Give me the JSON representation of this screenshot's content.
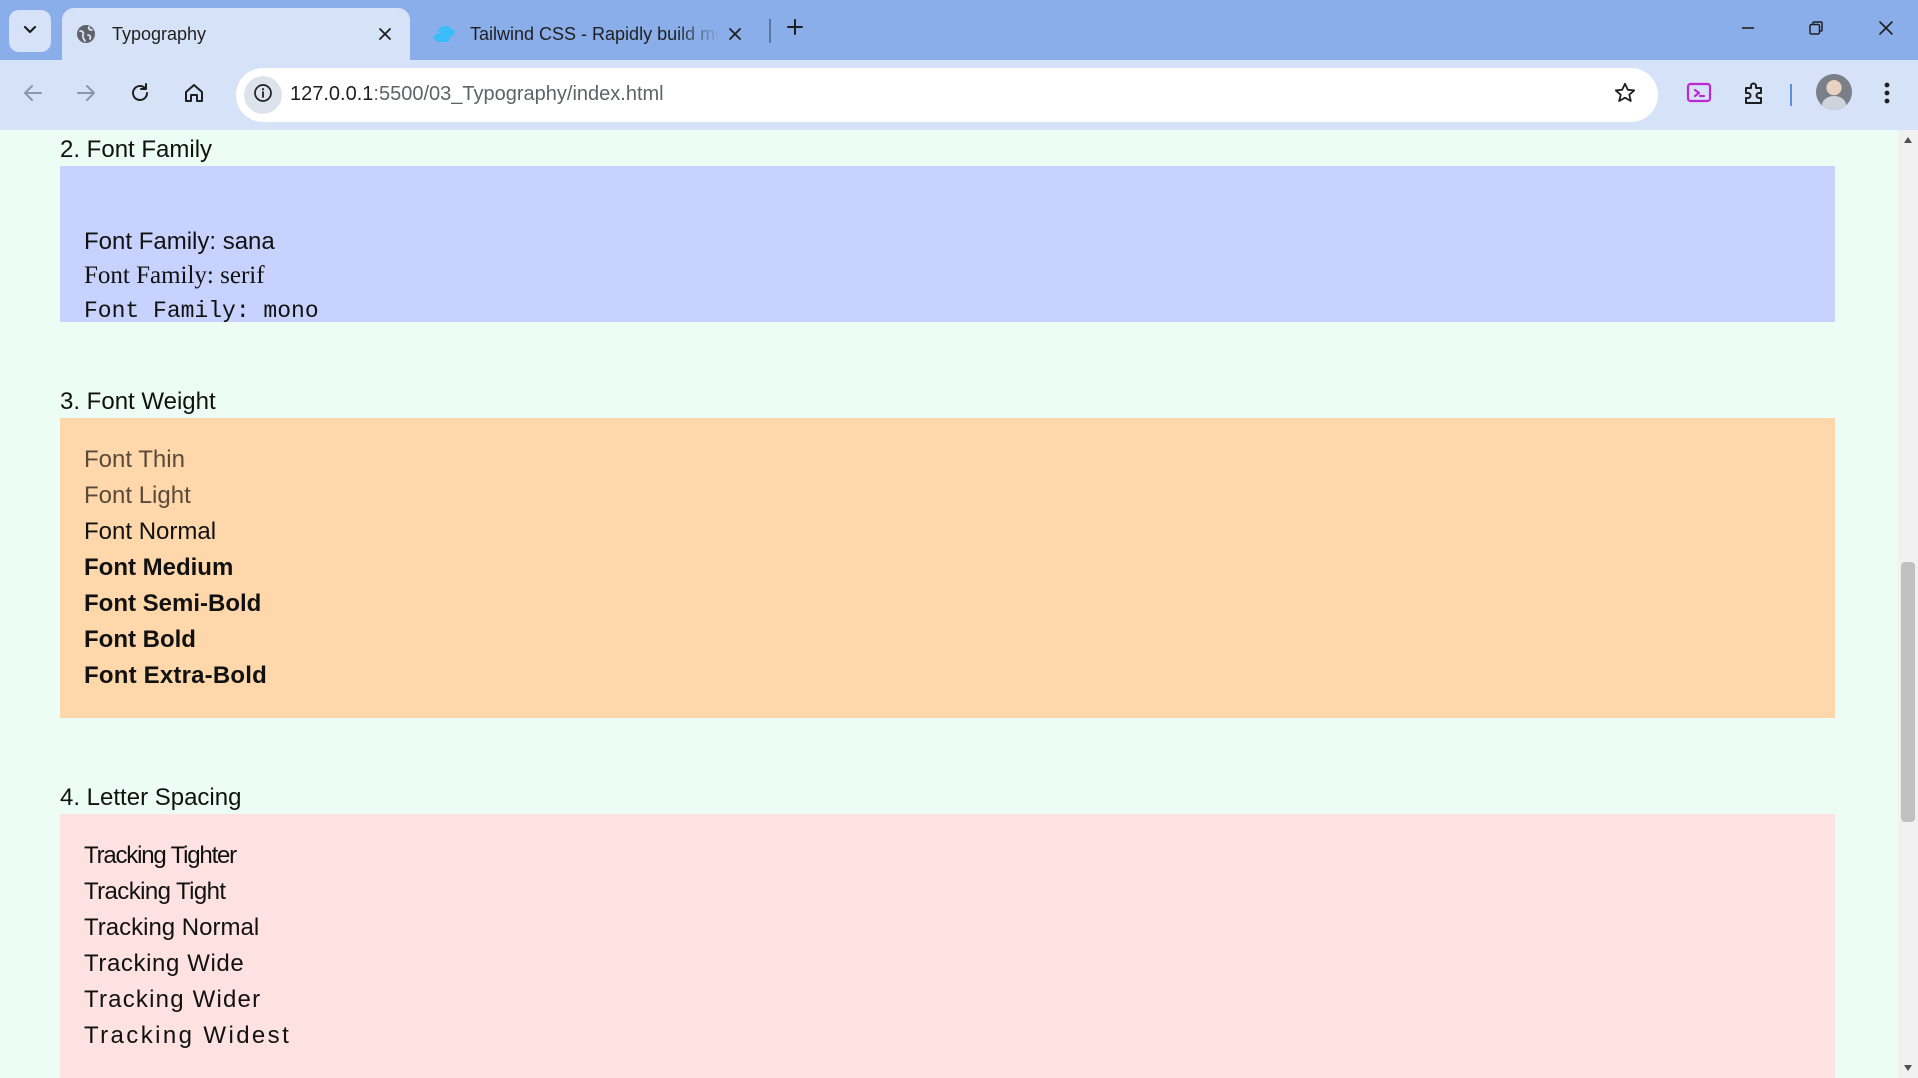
{
  "browser": {
    "tabs": [
      {
        "title": "Typography",
        "active": true,
        "favicon": "globe-icon"
      },
      {
        "title": "Tailwind CSS - Rapidly build modern websites without ever leaving your HTML",
        "active": false,
        "favicon": "tailwind-logo-icon"
      }
    ],
    "url": {
      "host": "127.0.0.1",
      "rest": ":5500/03_Typography/index.html"
    },
    "accent_color": "#8aaee9",
    "toolbar_color": "#d6e2f8"
  },
  "page": {
    "sections": {
      "font_family": {
        "title": "2. Font Family",
        "items": [
          "Font Family: sana",
          "Font Family: serif",
          "Font Family: mono"
        ],
        "color": "#c7d2fe"
      },
      "font_weight": {
        "title": "3. Font Weight",
        "items": [
          "Font Thin",
          "Font Light",
          "Font Normal",
          "Font Medium",
          "Font Semi-Bold",
          "Font Bold",
          "Font Extra-Bold"
        ],
        "color": "#fed7aa"
      },
      "letter_spacing": {
        "title": "4. Letter Spacing",
        "items": [
          "Tracking Tighter",
          "Tracking Tight",
          "Tracking Normal",
          "Tracking Wide",
          "Tracking Wider",
          "Tracking Widest"
        ],
        "color": "#fee2e2"
      }
    },
    "background": "#ecfdf5"
  },
  "scroll": {
    "position_fraction": 0.58
  }
}
